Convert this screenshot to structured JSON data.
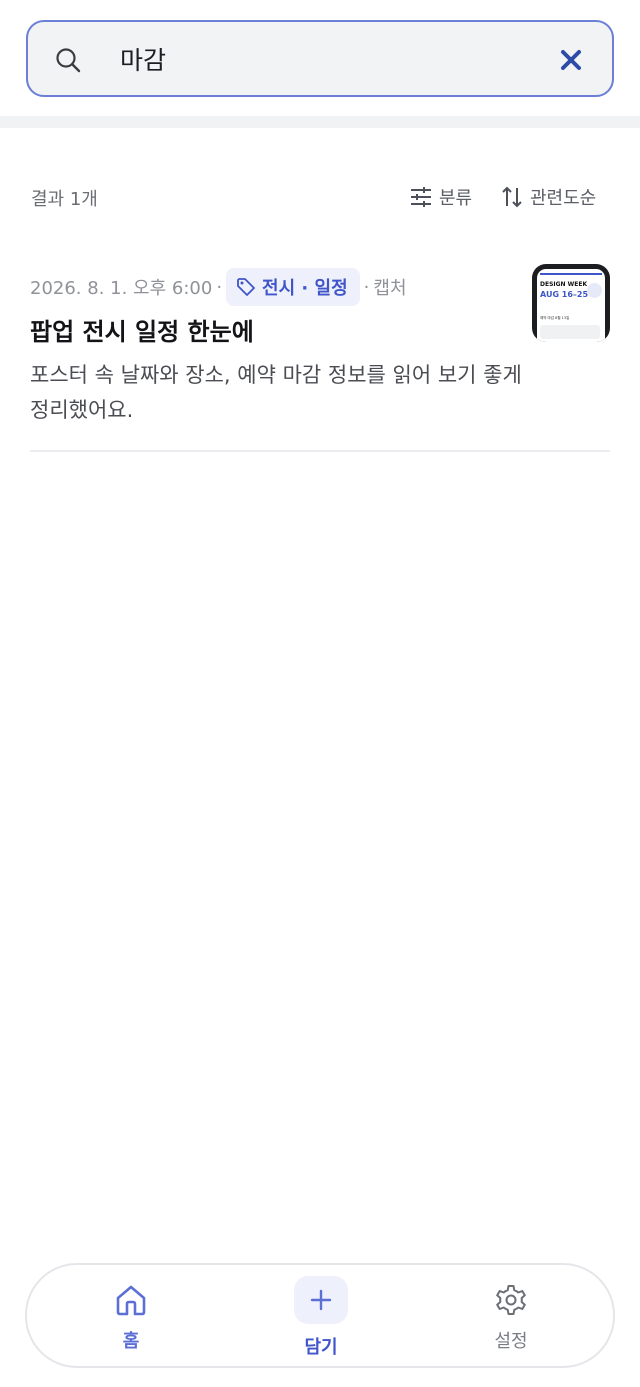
{
  "search": {
    "query": "마감"
  },
  "results": {
    "count_label": "결과 1개",
    "filter_label": "분류",
    "sort_label": "관련도순"
  },
  "items": [
    {
      "date": "2026. 8. 1. 오후 6:00",
      "separator": "·",
      "tag": "전시 · 일정",
      "source": "캡처",
      "title": "팝업 전시 일정 한눈에",
      "description": "포스터 속 날짜와 장소, 예약 마감 정보를 읽어 보기 좋게 정리했어요.",
      "thumbnail": {
        "heading": "DESIGN WEEK",
        "dates": "AUG 16–25",
        "note": "예약 마감 8월 13일"
      }
    }
  ],
  "nav": {
    "home_label": "홈",
    "add_label": "담기",
    "settings_label": "설정"
  },
  "colors": {
    "accent": "#3f55c9",
    "accent_light": "#eef0fb",
    "search_border": "#6b7fd7"
  },
  "icons": [
    "search-icon",
    "close-icon",
    "filter-icon",
    "sort-icon",
    "tag-icon",
    "home-icon",
    "plus-icon",
    "gear-icon"
  ]
}
